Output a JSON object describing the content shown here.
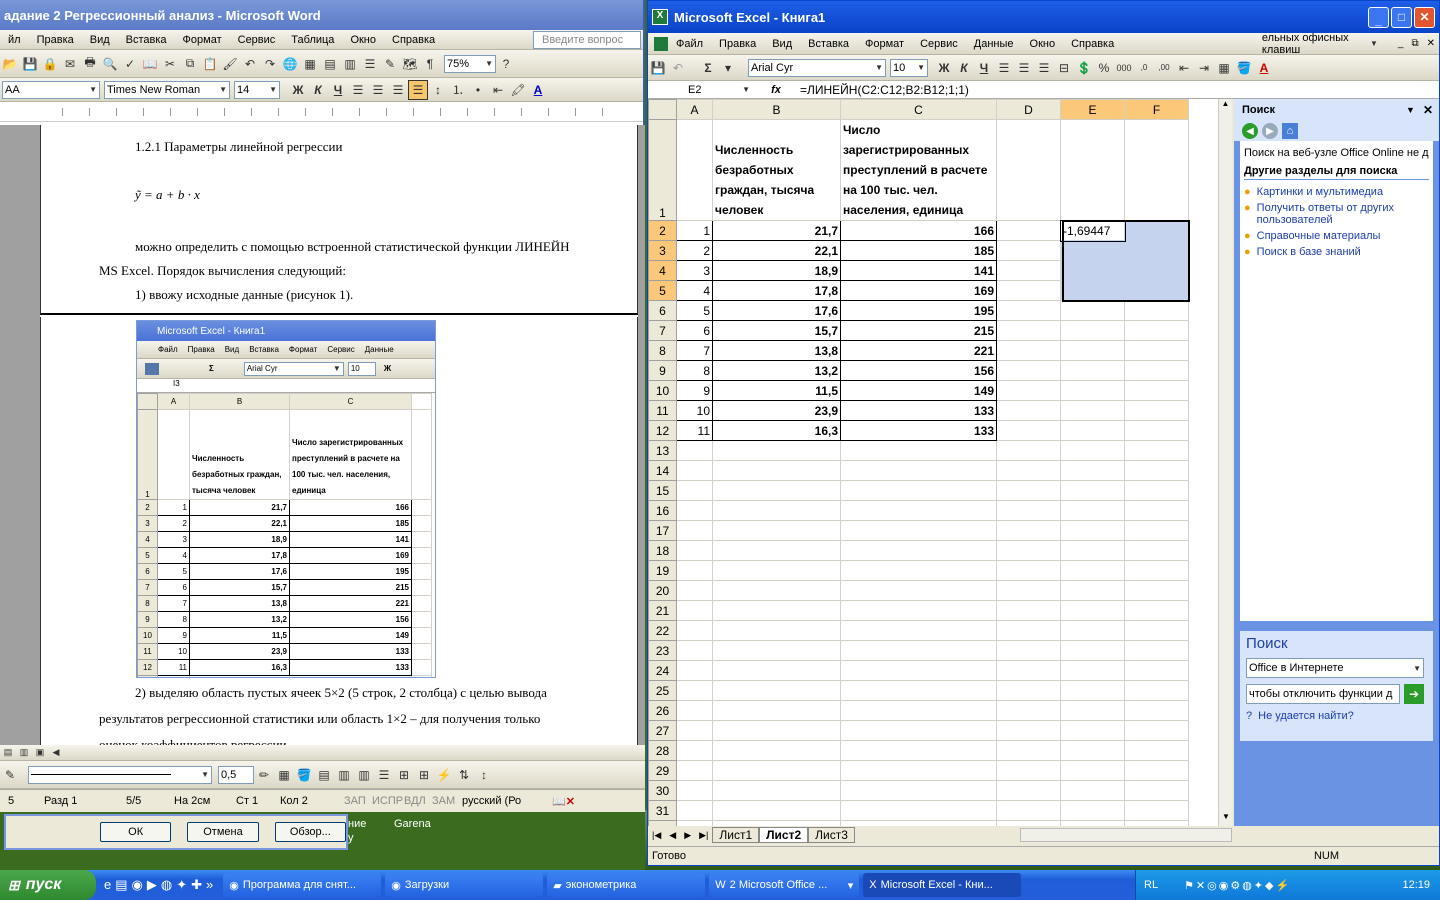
{
  "word": {
    "title": "адание 2 Регрессионный анализ - Microsoft Word",
    "menu": [
      "йл",
      "Правка",
      "Вид",
      "Вставка",
      "Формат",
      "Сервис",
      "Таблица",
      "Окно",
      "Справка"
    ],
    "ask_placeholder": "Введите вопрос",
    "zoom": "75%",
    "style": "АА",
    "font": "Times New Roman",
    "size": "14",
    "doc": {
      "heading": "1.2.1 Параметры линейной регрессии",
      "formula": "ỹ = a + b · x",
      "p1": "можно определить с помощью встроенной статистической функции ЛИНЕЙН",
      "p2": "MS Excel. Порядок вычисления следующий:",
      "p3": "1) ввожу исходные данные (рисунок 1).",
      "p4": "2) выделяю область пустых ячеек 5×2 (5 строк, 2 столбца) с целью вывода",
      "p5": "результатов регрессионной статистики или область 1×2 – для получения только",
      "p6": "оценок коэффициентов регрессии."
    },
    "embed": {
      "title": "Microsoft Excel - Книга1",
      "menu": [
        "Файл",
        "Правка",
        "Вид",
        "Вставка",
        "Формат",
        "Сервис",
        "Данные"
      ],
      "font": "Arial Cyr",
      "size": "10",
      "cellref": "I3"
    },
    "draw_size": "0,5",
    "status": {
      "page": "5",
      "section": "Разд 1",
      "pages": "5/5",
      "at": "На 2см",
      "line": "Ст 1",
      "col": "Кол 2",
      "rec": "ЗАП",
      "trk": "ИСПР",
      "ext": "ВДЛ",
      "ovr": "ЗАМ",
      "lang": "русский (Ро"
    }
  },
  "dialog": {
    "ok": "ОК",
    "cancel": "Отмена",
    "browse": "Обзор..."
  },
  "desktop": {
    "text1": "ние",
    "text2": "Garena",
    "text3": "у"
  },
  "excel": {
    "title": "Microsoft Excel - Книга1",
    "menu": [
      "Файл",
      "Правка",
      "Вид",
      "Вставка",
      "Формат",
      "Сервис",
      "Данные",
      "Окно",
      "Справка"
    ],
    "help_box": "ельных офисных клавиш",
    "font": "Arial Cyr",
    "size": "10",
    "name_box": "E2",
    "formula": "=ЛИНЕЙН(C2:C12;B2:B12;1;1)",
    "columns": [
      "A",
      "B",
      "C",
      "D",
      "E",
      "F"
    ],
    "header_b": "Численность безработных граждан, тысяча человек",
    "header_c": "Число зарегистрированных преступлений в расчете на 100 тыс. чел. населения, единица",
    "rows": [
      [
        "1",
        "21,7",
        "166"
      ],
      [
        "2",
        "22,1",
        "185"
      ],
      [
        "3",
        "18,9",
        "141"
      ],
      [
        "4",
        "17,8",
        "169"
      ],
      [
        "5",
        "17,6",
        "195"
      ],
      [
        "6",
        "15,7",
        "215"
      ],
      [
        "7",
        "13,8",
        "221"
      ],
      [
        "8",
        "13,2",
        "156"
      ],
      [
        "9",
        "11,5",
        "149"
      ],
      [
        "10",
        "23,9",
        "133"
      ],
      [
        "11",
        "16,3",
        "133"
      ]
    ],
    "e2": "-1,69447",
    "sheets": [
      "Лист1",
      "Лист2",
      "Лист3"
    ],
    "status": "Готово",
    "num": "NUM"
  },
  "pane": {
    "title": "Поиск",
    "online_text": "Поиск на веб-узле Office Online не дал",
    "section": "Другие разделы для поиска",
    "links": [
      "Картинки и мультимедиа",
      "Получить ответы от других пользователей",
      "Справочные материалы",
      "Поиск в базе знаний"
    ],
    "search_title": "Поиск",
    "scope": "Office в Интернете",
    "query": "чтобы отключить функции д",
    "help": "Не удается найти?"
  },
  "taskbar": {
    "start": "пуск",
    "items": [
      "Программа для снят...",
      "Загрузки",
      "эконометрика",
      "2 Microsoft Office ...",
      "Microsoft Excel - Кни..."
    ],
    "lang": "RL",
    "time": "12:19"
  }
}
